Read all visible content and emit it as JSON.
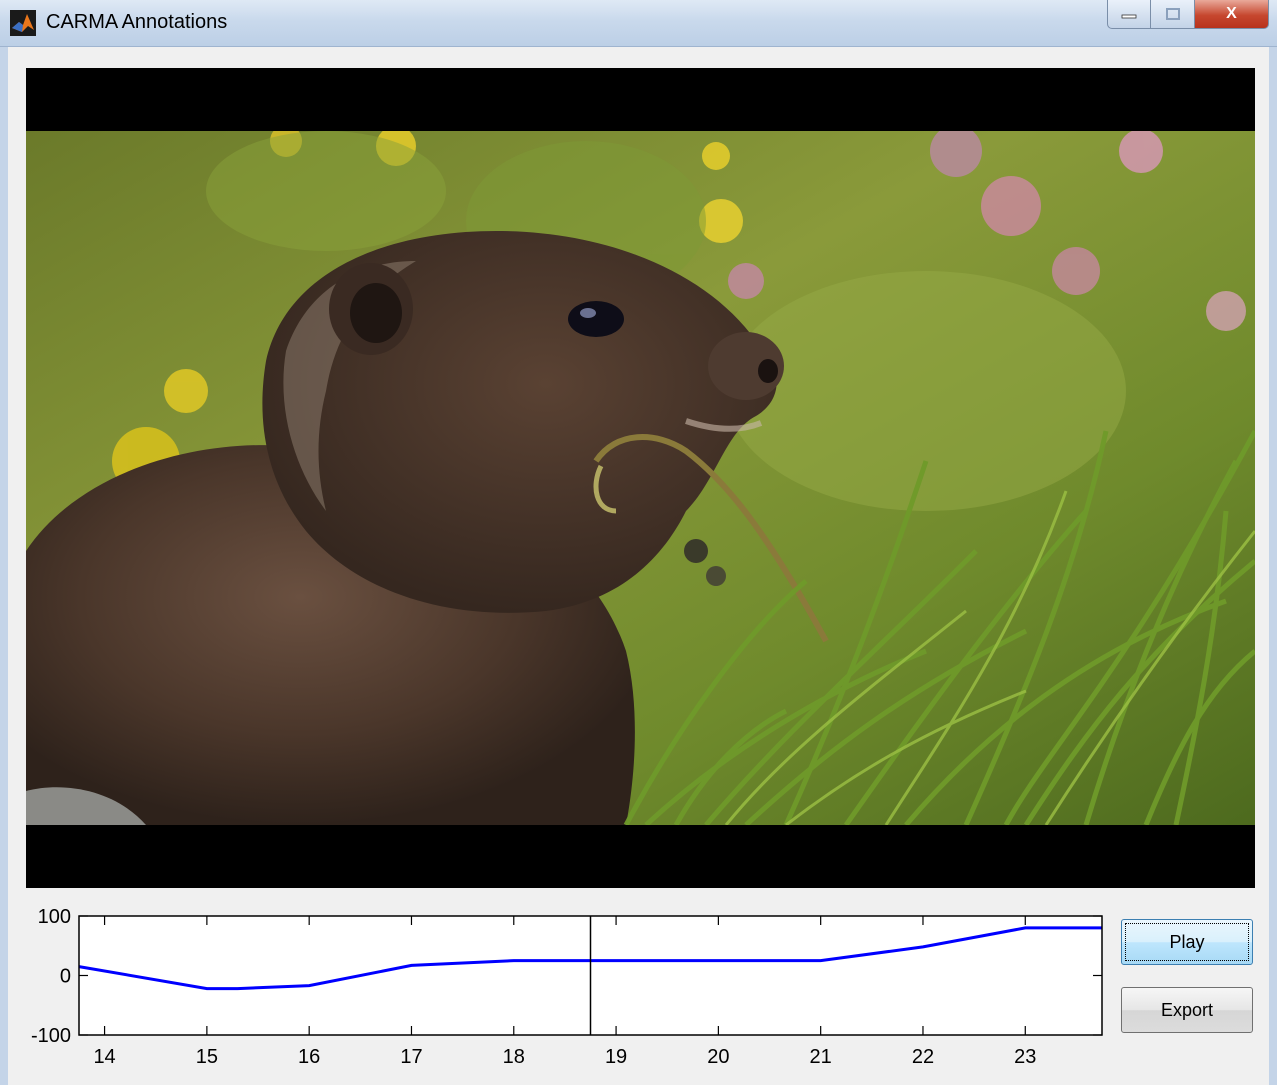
{
  "window": {
    "title": "CARMA Annotations",
    "close_glyph": "X"
  },
  "video": {
    "scene": "marmot-eating-grass-in-meadow"
  },
  "buttons": {
    "play_label": "Play",
    "export_label": "Export"
  },
  "chart_data": {
    "type": "line",
    "title": "",
    "xlabel": "",
    "ylabel": "",
    "xlim": [
      13.75,
      23.75
    ],
    "ylim": [
      -100,
      100
    ],
    "x_ticks": [
      14,
      15,
      16,
      17,
      18,
      19,
      20,
      21,
      22,
      23
    ],
    "x_tick_labels": [
      "14",
      "15",
      "16",
      "17",
      "18",
      "19",
      "20",
      "21",
      "22",
      "23"
    ],
    "y_ticks": [
      -100,
      0,
      100
    ],
    "y_tick_labels": [
      "-100",
      "0",
      "100"
    ],
    "grid": false,
    "cursor_x": 18.75,
    "series": [
      {
        "color": "#0000ff",
        "x": [
          13.75,
          15.0,
          15.3,
          16.0,
          17.0,
          18.0,
          19.0,
          20.0,
          21.0,
          22.0,
          23.0,
          23.75
        ],
        "y": [
          15,
          -22,
          -22,
          -17,
          17,
          25,
          25,
          25,
          25,
          48,
          80,
          80
        ]
      }
    ]
  }
}
